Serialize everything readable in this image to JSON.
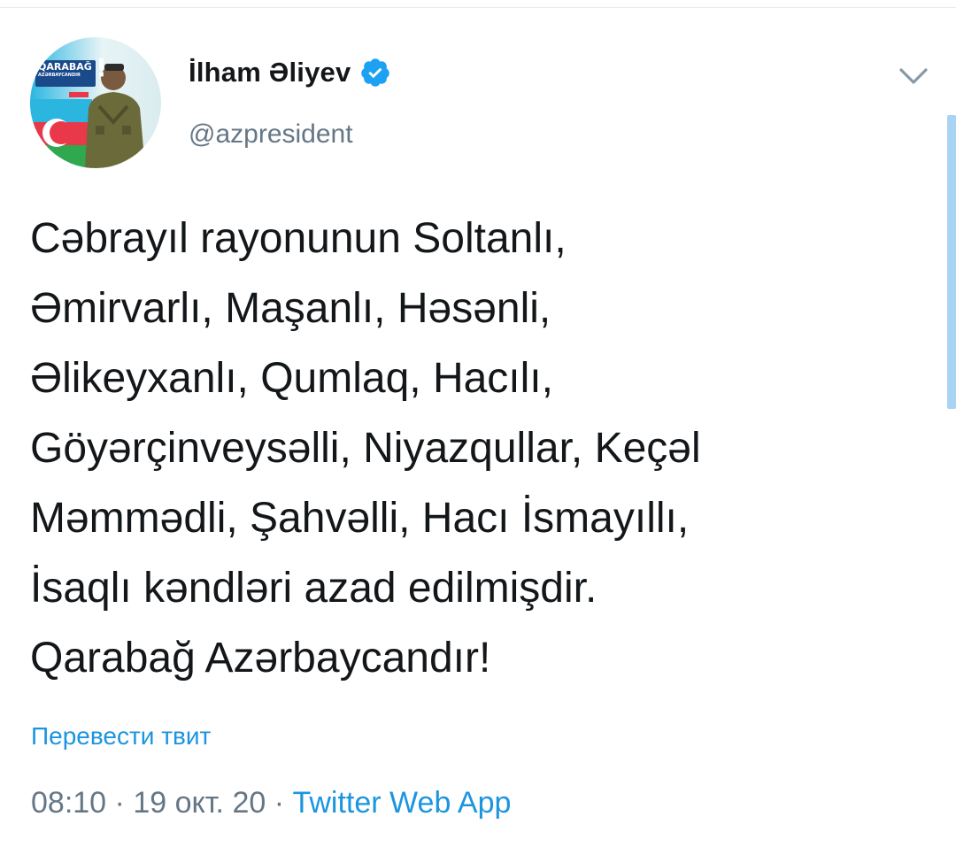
{
  "tweet": {
    "author": {
      "name": "İlham Əliyev",
      "handle": "@azpresident",
      "verified": true,
      "avatar": {
        "badge_line1": "QARABAĞ",
        "badge_line2": "AZƏRBAYCANDIR",
        "badge_mark": "!"
      }
    },
    "text": "Cəbrayıl rayonunun Soltanlı,\nƏmirvarlı, Maşanlı, Həsənli,\nƏlikeyxanlı, Qumlaq, Hacılı,\nGöyərçinveysəlli, Niyazqullar, Keçəl\nMəmmədli, Şahvəlli, Hacı İsmayıllı,\nİsaqlı kəndləri azad edilmişdir.\nQarabağ Azərbaycandır!",
    "translate_label": "Перевести твит",
    "time": "08:10",
    "date": "19 окт. 20",
    "separator": " · ",
    "source": "Twitter Web App"
  },
  "icons": {
    "verified": "verified-badge-icon",
    "menu": "chevron-down-icon"
  },
  "colors": {
    "text": "#14171a",
    "secondary": "#657786",
    "link": "#1b95e0",
    "verified": "#1da1f2"
  }
}
